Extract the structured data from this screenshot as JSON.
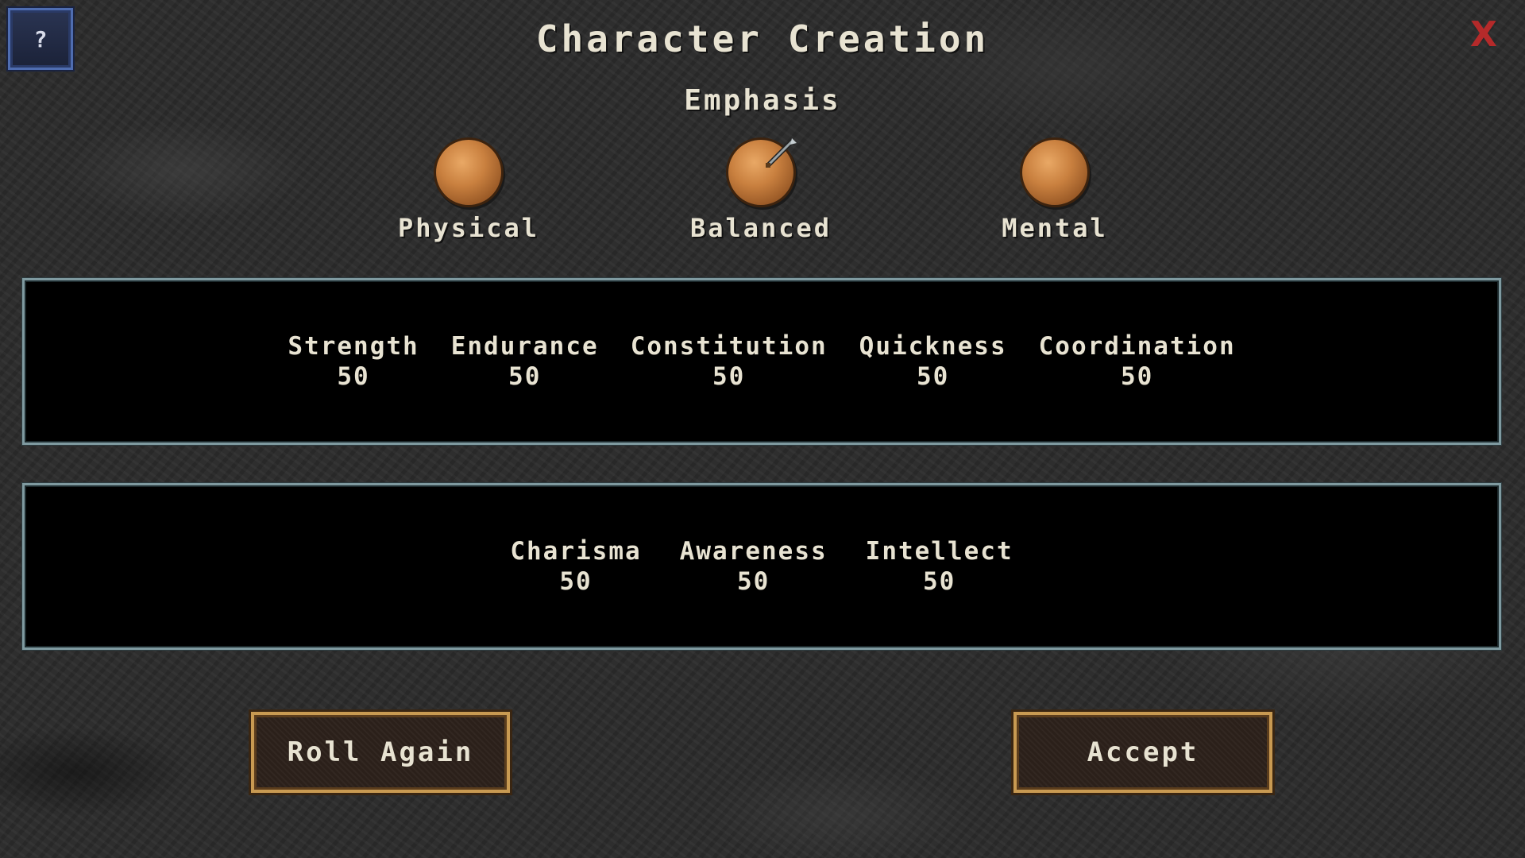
{
  "header": {
    "help_label": "?",
    "close_label": "X",
    "title": "Character Creation",
    "subtitle": "Emphasis"
  },
  "emphasis": {
    "options": [
      {
        "label": "Physical",
        "icon": "orb-icon"
      },
      {
        "label": "Balanced",
        "icon": "orb-icon",
        "selected": true
      },
      {
        "label": "Mental",
        "icon": "orb-icon"
      }
    ]
  },
  "physical_stats": [
    {
      "name": "Strength",
      "value": "50"
    },
    {
      "name": "Endurance",
      "value": "50"
    },
    {
      "name": "Constitution",
      "value": "50"
    },
    {
      "name": "Quickness",
      "value": "50"
    },
    {
      "name": "Coordination",
      "value": "50"
    }
  ],
  "mental_stats": [
    {
      "name": "Charisma",
      "value": "50"
    },
    {
      "name": "Awareness",
      "value": "50"
    },
    {
      "name": "Intellect",
      "value": "50"
    }
  ],
  "buttons": {
    "roll_again": "Roll Again",
    "accept": "Accept"
  },
  "colors": {
    "panel_border": "#7f9aa0",
    "button_border": "#c89a52",
    "close": "#b52a2a",
    "help_border": "#4f6db0"
  }
}
